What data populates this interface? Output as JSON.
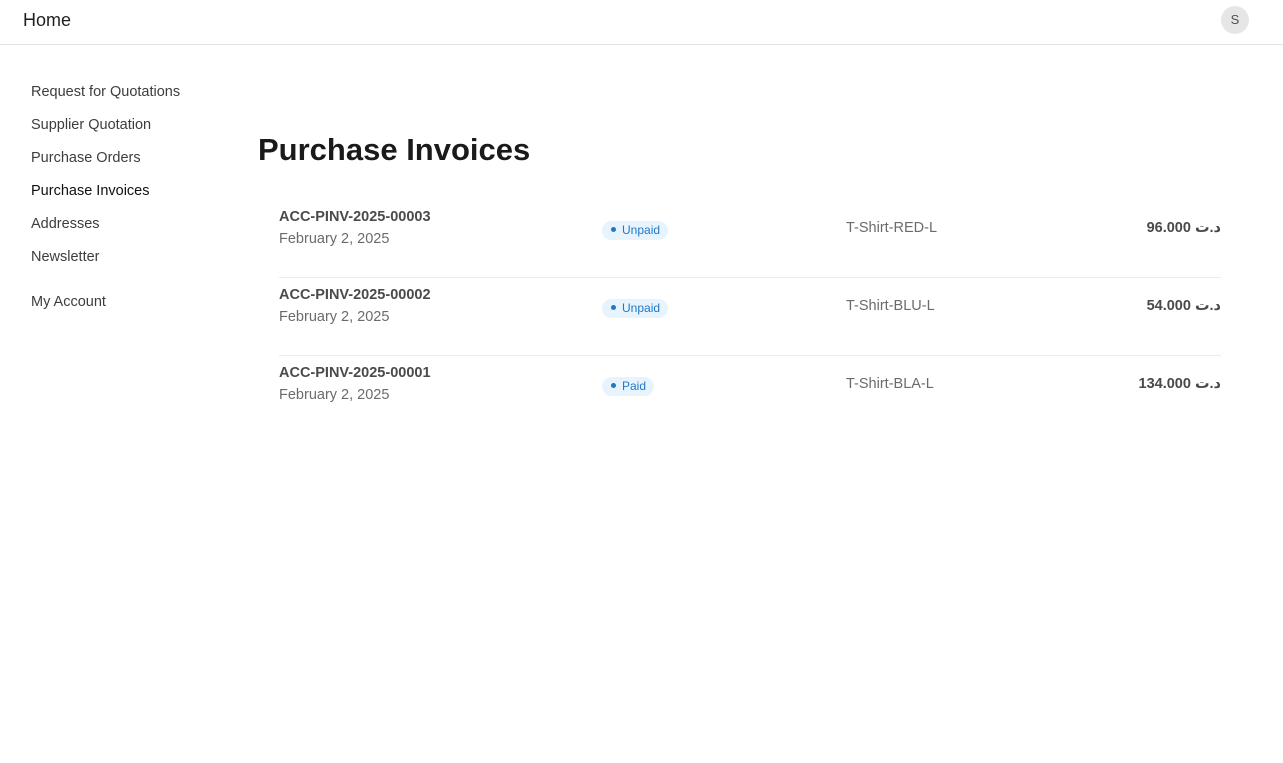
{
  "navbar": {
    "brand": "Home",
    "avatar_initial": "S"
  },
  "sidebar": {
    "items": [
      {
        "label": "Request for Quotations"
      },
      {
        "label": "Supplier Quotation"
      },
      {
        "label": "Purchase Orders"
      },
      {
        "label": "Purchase Invoices",
        "active": true
      },
      {
        "label": "Addresses"
      },
      {
        "label": "Newsletter"
      }
    ],
    "account_label": "My Account"
  },
  "main": {
    "title": "Purchase Invoices",
    "invoices": [
      {
        "name": "ACC-PINV-2025-00003",
        "date": "February 2, 2025",
        "status": "Unpaid",
        "item": "T-Shirt-RED-L",
        "amount": "د.ت 96.000"
      },
      {
        "name": "ACC-PINV-2025-00002",
        "date": "February 2, 2025",
        "status": "Unpaid",
        "item": "T-Shirt-BLU-L",
        "amount": "د.ت 54.000"
      },
      {
        "name": "ACC-PINV-2025-00001",
        "date": "February 2, 2025",
        "status": "Paid",
        "item": "T-Shirt-BLA-L",
        "amount": "د.ت 134.000"
      }
    ]
  },
  "colors": {
    "status_badge_bg": "#e8f4fd",
    "status_badge_text": "#1f78c8"
  }
}
